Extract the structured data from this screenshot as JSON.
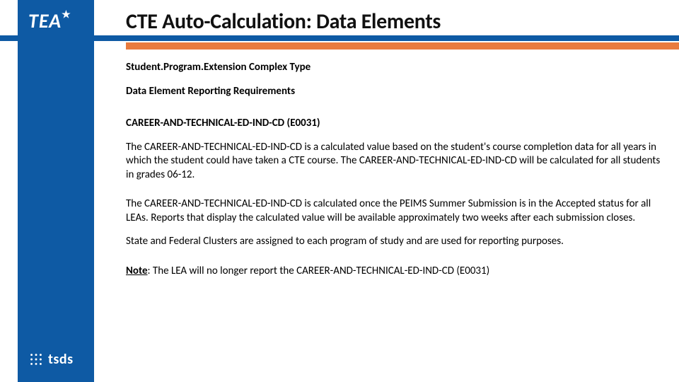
{
  "logos": {
    "tea": "TEA",
    "tsds": "tsds"
  },
  "title": "CTE Auto-Calculation: Data Elements",
  "sections": {
    "complex_type": "Student.Program.Extension Complex Type",
    "subhead": "Data Element Reporting Requirements",
    "element_heading": "CAREER-AND-TECHNICAL-ED-IND-CD (E0031)",
    "para1": "The CAREER-AND-TECHNICAL-ED-IND-CD is a calculated value based on the student's course completion data for all years in which the student could have taken a CTE course. The CAREER-AND-TECHNICAL-ED-IND-CD will be calculated for all students in grades 06-12.",
    "para2": "The CAREER-AND-TECHNICAL-ED-IND-CD is calculated once the PEIMS Summer Submission is in the Accepted status for all LEAs. Reports that display the calculated value will be available approximately two weeks after each submission closes.",
    "para3": "State and Federal Clusters are assigned to each program of study and are used for reporting purposes.",
    "note_label": "Note",
    "note_text": ": The LEA will no longer report the CAREER-AND-TECHNICAL-ED-IND-CD (E0031)"
  }
}
